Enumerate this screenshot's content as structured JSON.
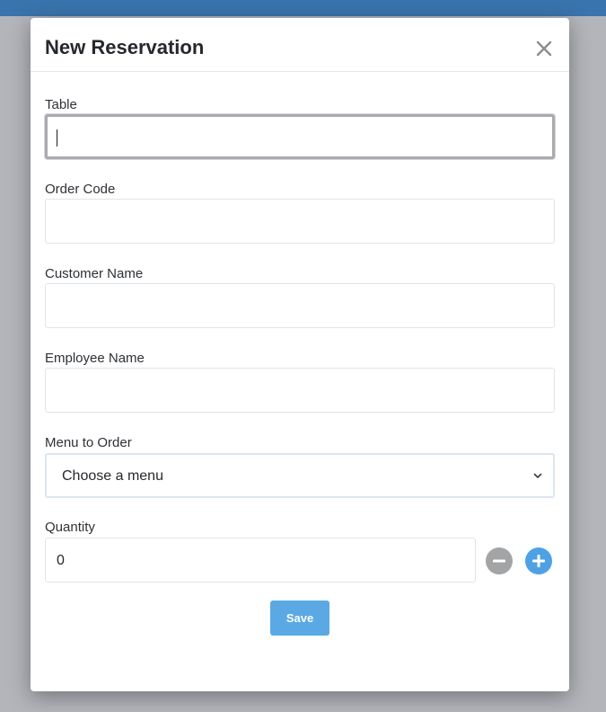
{
  "modal": {
    "title": "New Reservation"
  },
  "fields": {
    "table": {
      "label": "Table",
      "value": ""
    },
    "order_code": {
      "label": "Order Code",
      "value": ""
    },
    "customer_name": {
      "label": "Customer Name",
      "value": ""
    },
    "employee_name": {
      "label": "Employee Name",
      "value": ""
    },
    "menu": {
      "label": "Menu to Order",
      "selected": "Choose a menu"
    },
    "quantity": {
      "label": "Quantity",
      "value": "0"
    }
  },
  "actions": {
    "save_label": "Save"
  },
  "icons": {
    "close": "close-icon",
    "chevron": "chevron-down-icon",
    "minus": "minus-circle-icon",
    "plus": "plus-circle-icon"
  },
  "colors": {
    "top_band": "#3a74ad",
    "plus_button": "#4ea1e4",
    "minus_button": "#a3a4a6",
    "save_button": "#5aa9e4"
  }
}
